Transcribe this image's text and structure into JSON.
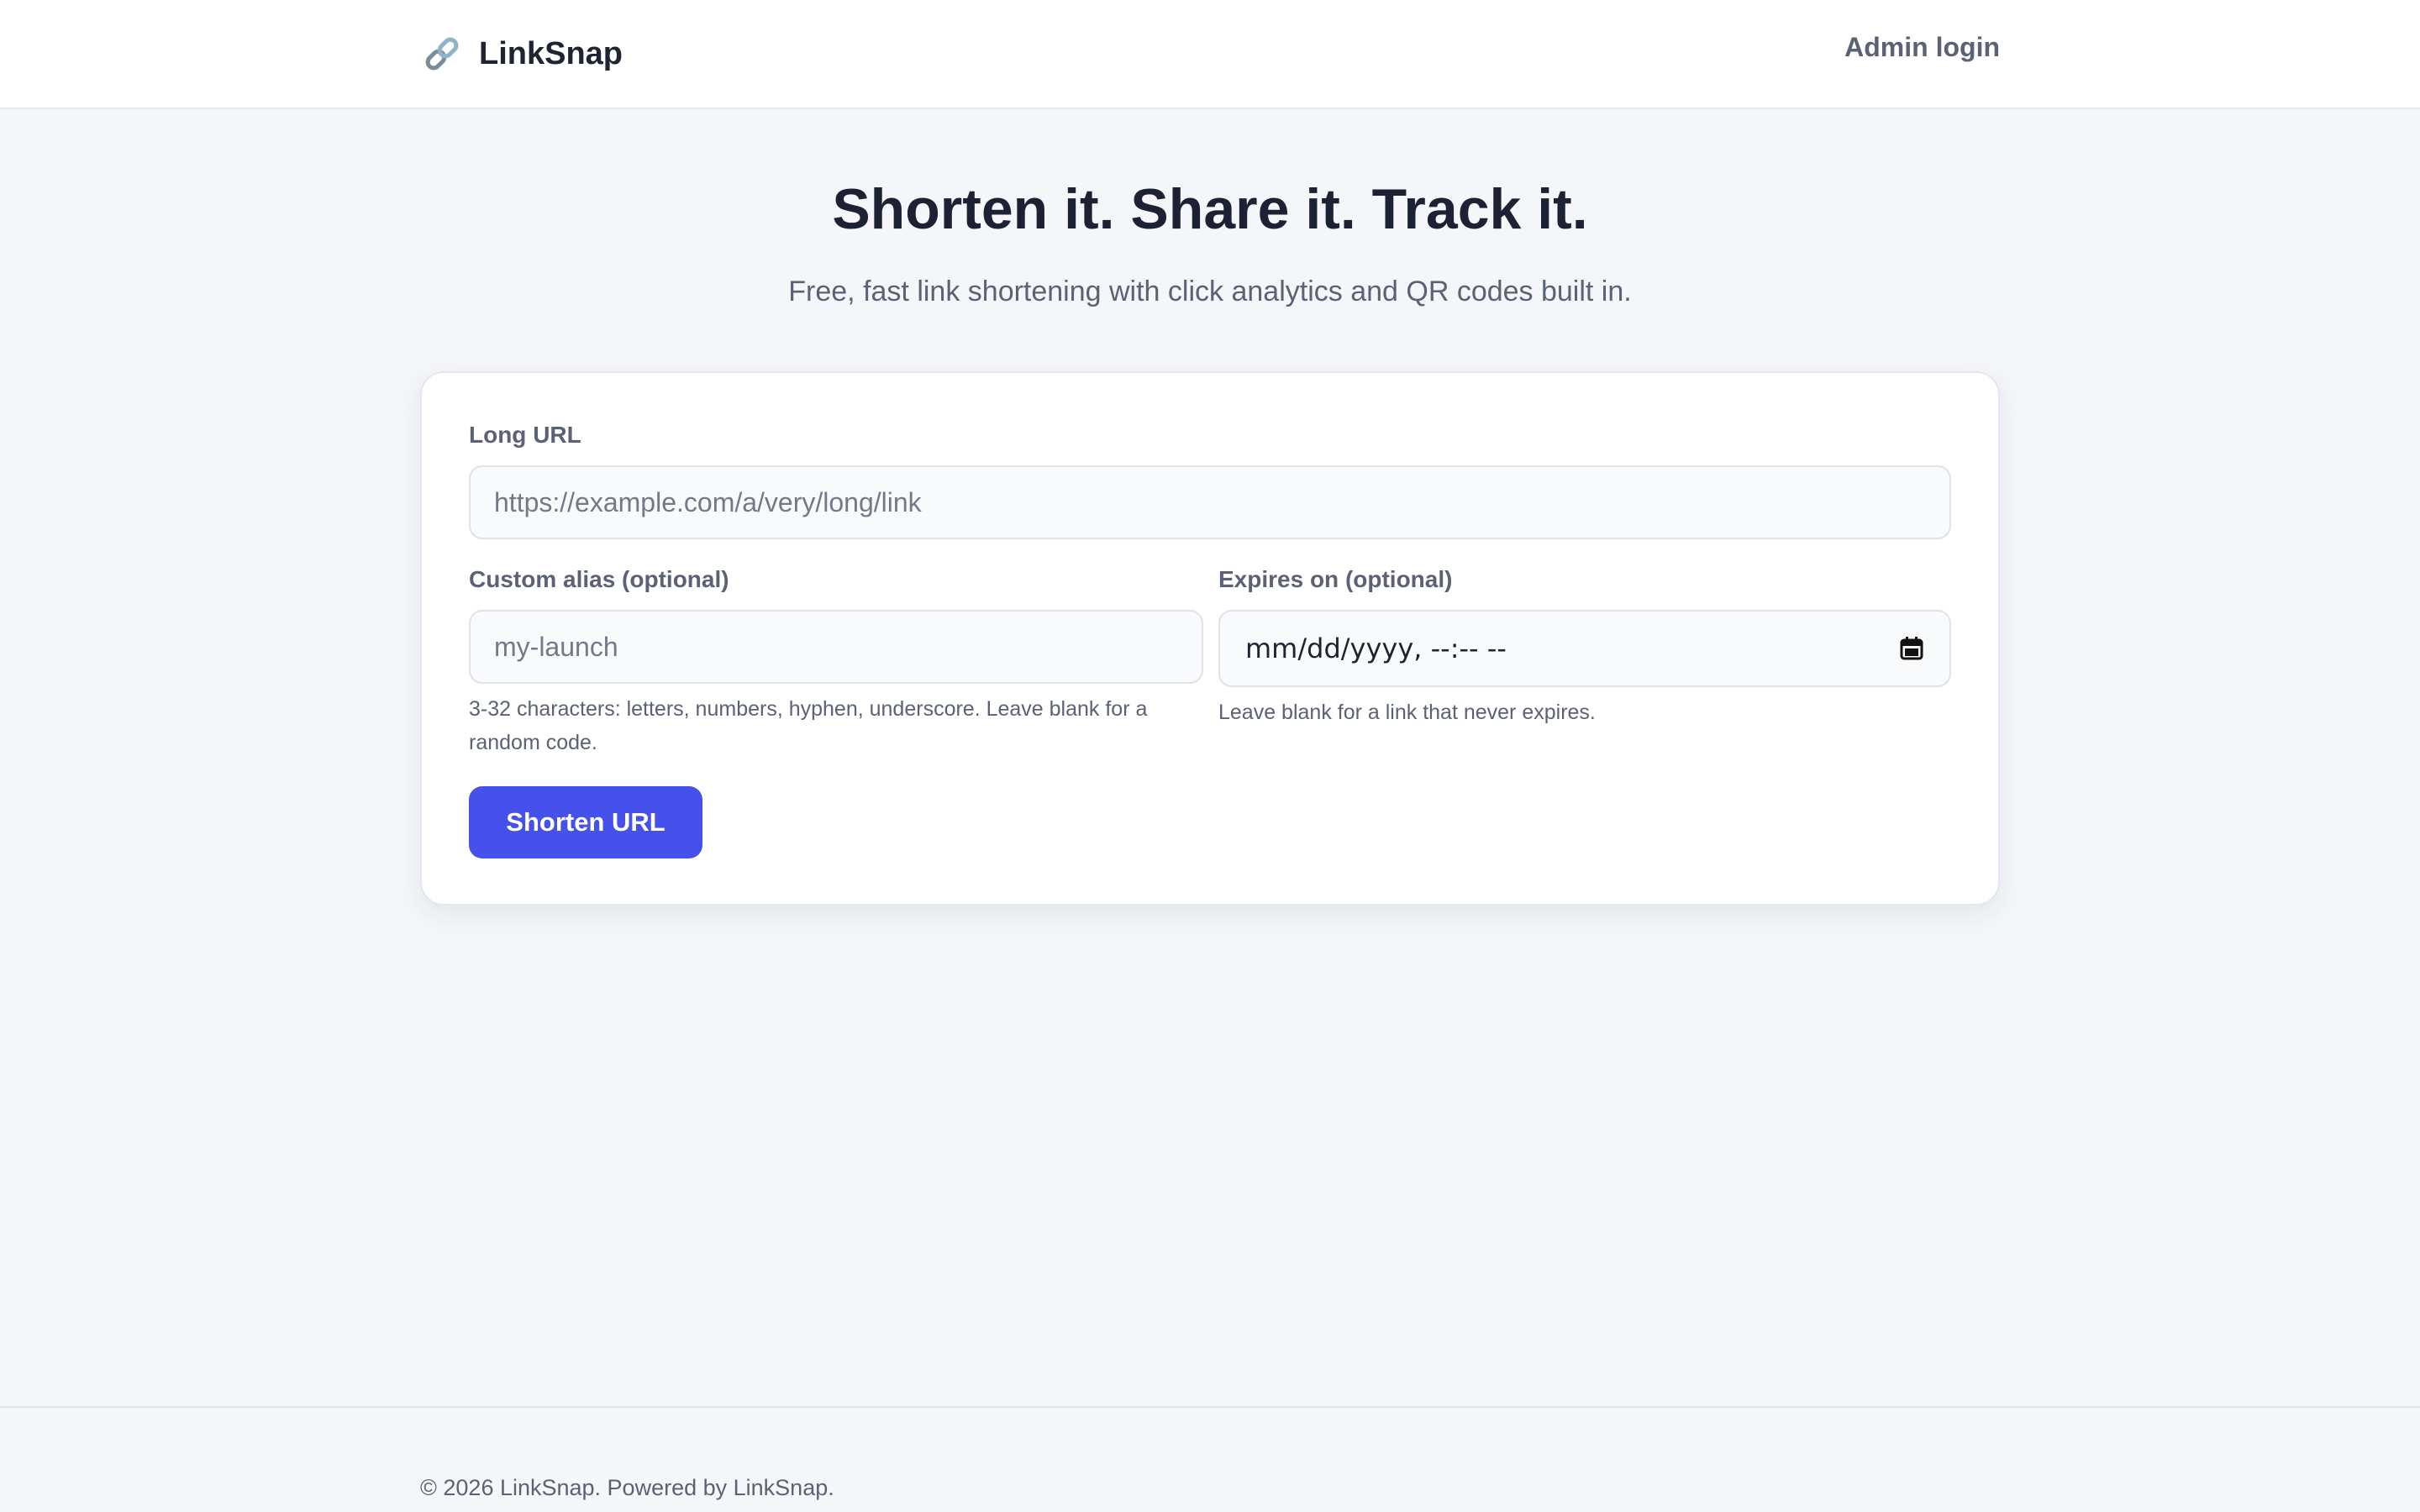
{
  "header": {
    "brand_icon": "link-icon",
    "brand_name": "LinkSnap",
    "admin_link": "Admin login"
  },
  "hero": {
    "title": "Shorten it. Share it. Track it.",
    "subtitle": "Free, fast link shortening with click analytics and QR codes built in."
  },
  "form": {
    "long_url": {
      "label": "Long URL",
      "value": "",
      "placeholder": "https://example.com/a/very/long/link"
    },
    "alias": {
      "label": "Custom alias (optional)",
      "value": "",
      "placeholder": "my-launch",
      "help": "3-32 characters: letters, numbers, hyphen, underscore. Leave blank for a random code."
    },
    "expires": {
      "label": "Expires on (optional)",
      "value_display": "mm/dd/yyyy, --:-- --",
      "icon": "calendar-icon",
      "help": "Leave blank for a link that never expires."
    },
    "submit_label": "Shorten URL"
  },
  "footer": {
    "text": "© 2026 LinkSnap. Powered by LinkSnap."
  },
  "colors": {
    "accent": "#4551ea",
    "background": "#f4f6fa",
    "text_muted": "#5b6275"
  }
}
